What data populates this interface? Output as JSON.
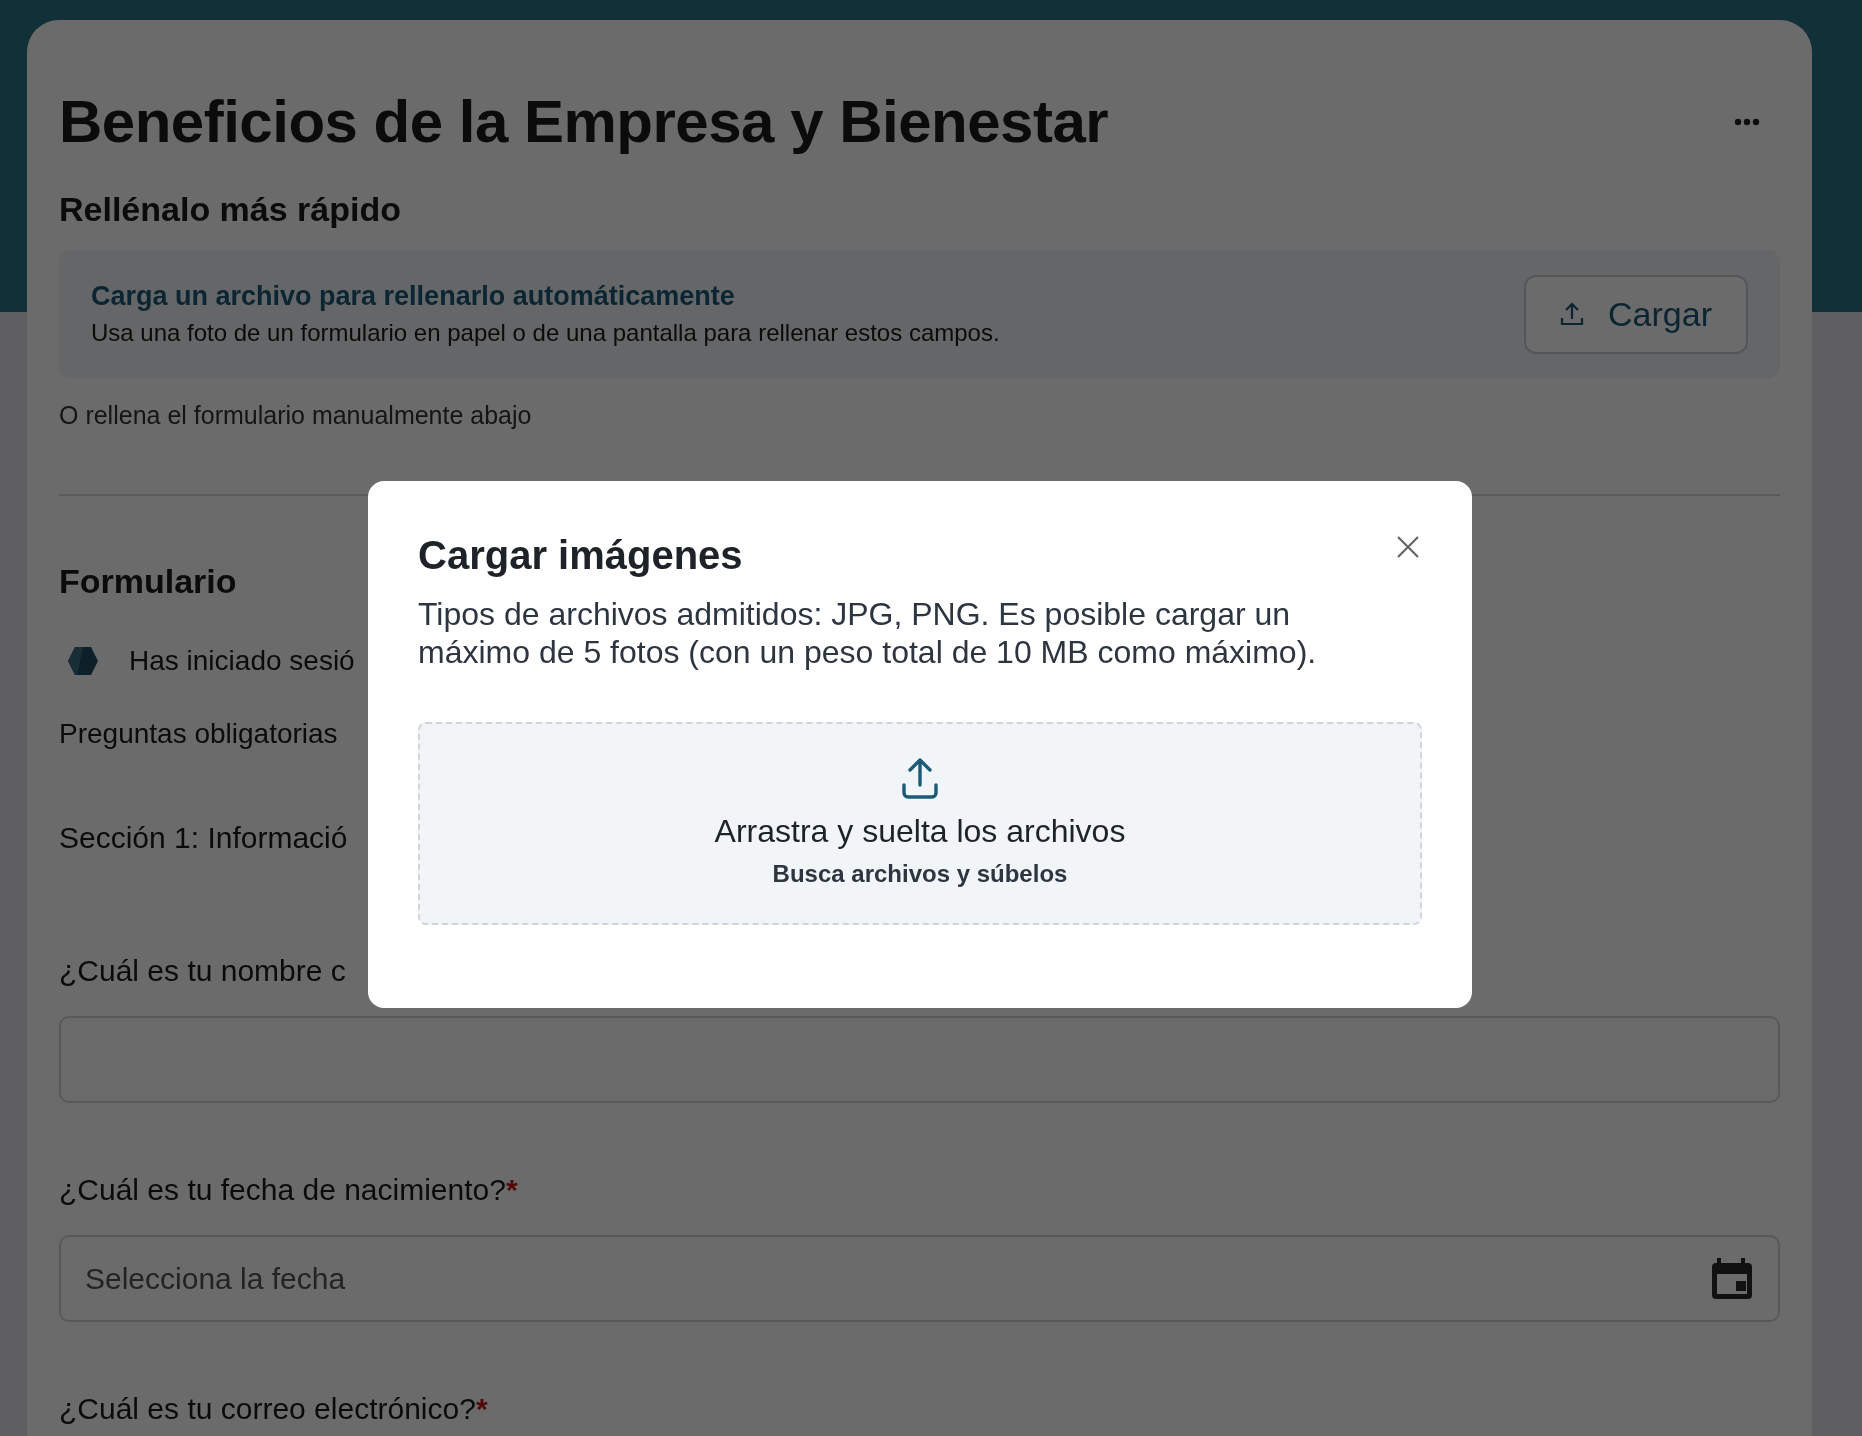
{
  "page": {
    "title": "Beneficios de la Empresa y Bienestar"
  },
  "quick_fill": {
    "heading": "Rellénalo más rápido",
    "link": "Carga un archivo para rellenarlo automáticamente",
    "description": "Usa una foto de un formulario en papel o de una pantalla para rellenar estos campos.",
    "button": "Cargar"
  },
  "manual_note": "O rellena el formulario manualmente abajo",
  "form": {
    "heading": "Formulario",
    "signed_in": "Has iniciado sesió",
    "required_note": "Preguntas obligatorias",
    "section": "Sección 1: Informació",
    "questions": [
      {
        "kind": "text",
        "label": "¿Cuál es tu nombre c"
      },
      {
        "kind": "date",
        "label": "¿Cuál es tu fecha de nacimiento?",
        "required_mark": "*",
        "placeholder": "Selecciona la fecha"
      },
      {
        "kind": "email",
        "label": "¿Cuál es tu correo electrónico?",
        "required_mark": "*"
      }
    ]
  },
  "modal": {
    "title": "Cargar imágenes",
    "description": "Tipos de archivos admitidos: JPG, PNG. Es posible cargar un máximo de 5 fotos (con un peso total de 10 MB como máximo).",
    "dropzone": {
      "title": "Arrastra y suelta los archivos",
      "link": "Busca archivos y súbelos"
    }
  }
}
